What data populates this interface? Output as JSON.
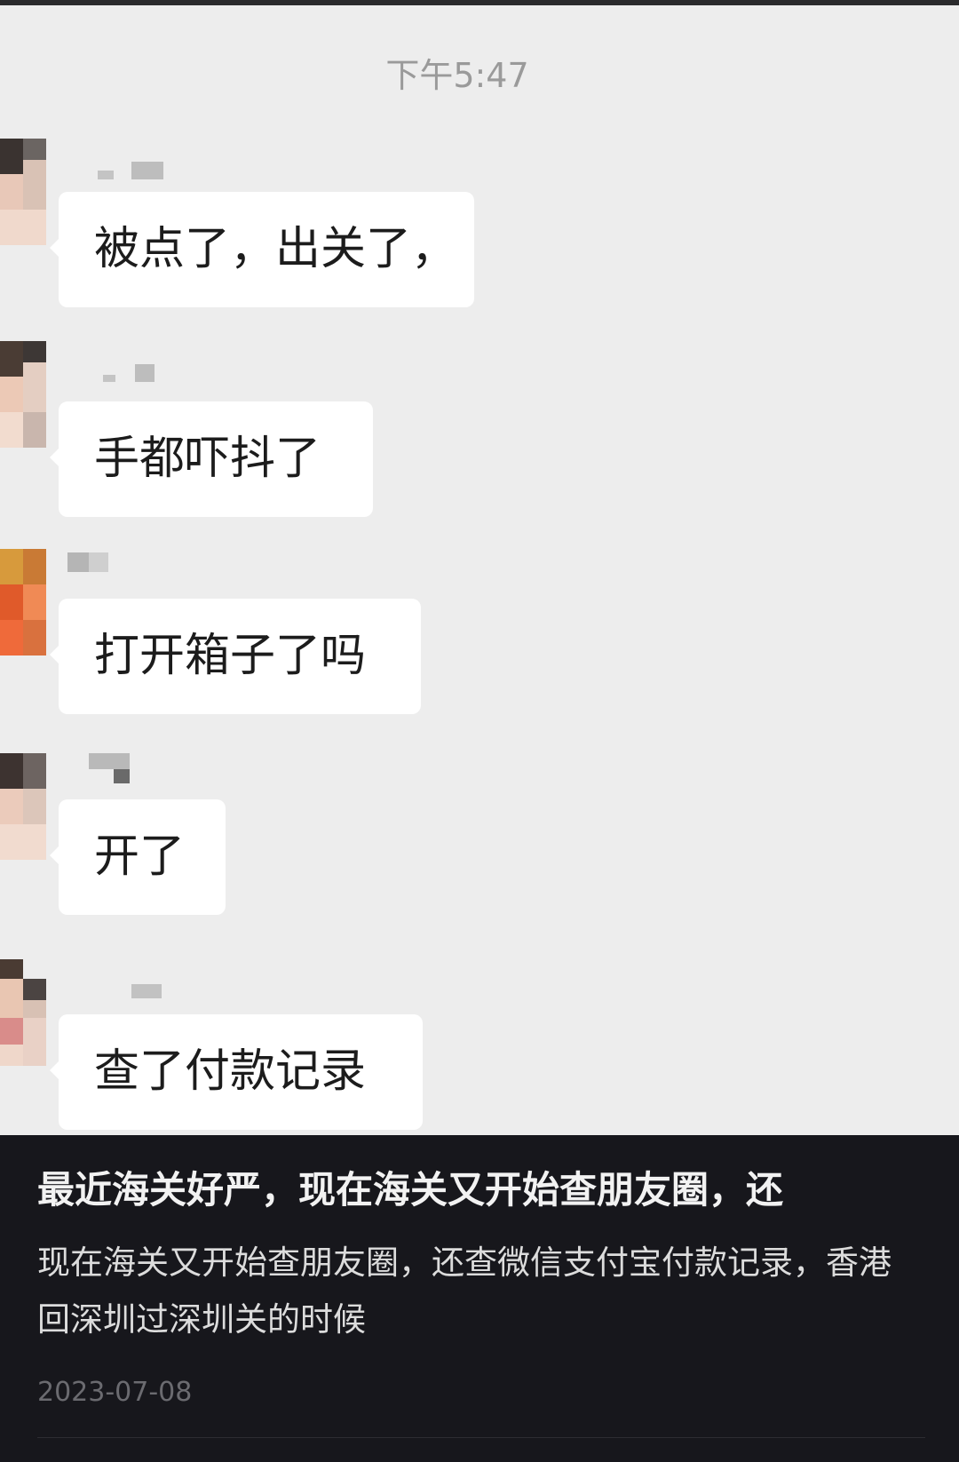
{
  "chat": {
    "timestamp": "下午5:47",
    "messages": [
      {
        "text": "被点了，出关了，"
      },
      {
        "text": "手都吓抖了"
      },
      {
        "text": "打开箱子了吗"
      },
      {
        "text": "开了"
      },
      {
        "text": "查了付款记录"
      }
    ]
  },
  "caption": {
    "title": "最近海关好严，现在海关又开始查朋友圈，还",
    "description": "现在海关又开始查朋友圈，还查微信支付宝付款记录，香港回深圳过深圳关的时候",
    "date": "2023-07-08"
  },
  "colors": {
    "chat_background": "#ededed",
    "bubble": "#ffffff",
    "caption_background": "#17171c"
  }
}
